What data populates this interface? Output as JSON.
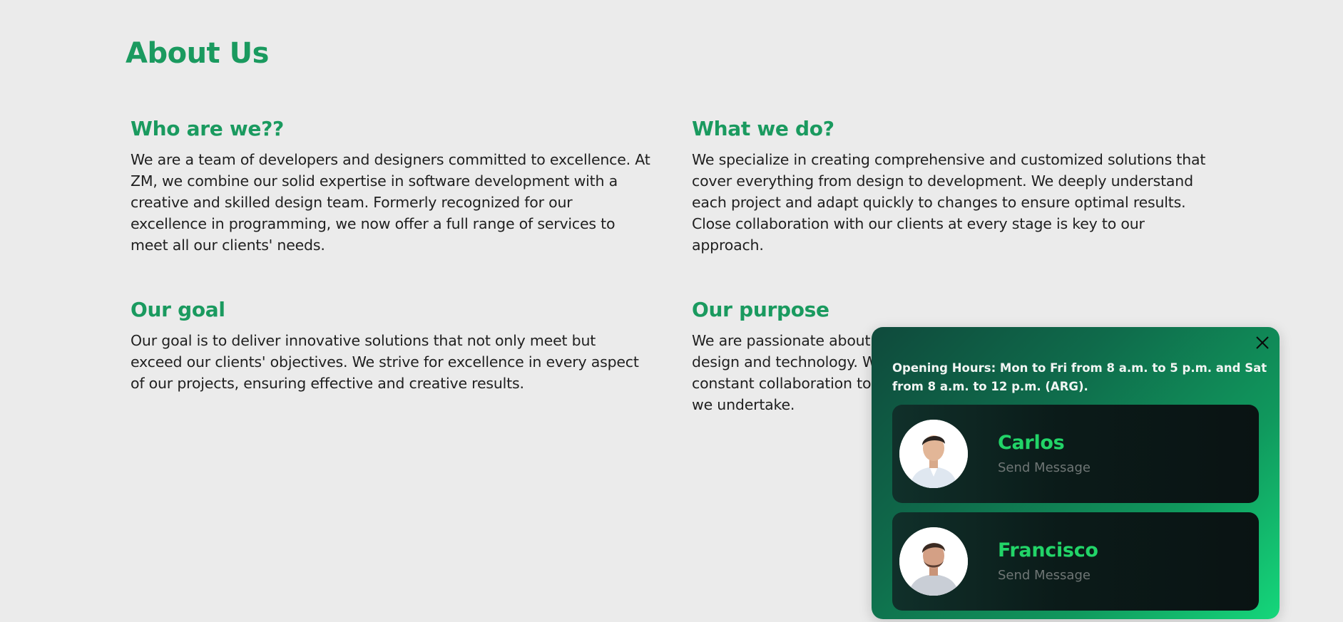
{
  "page": {
    "title": "About Us"
  },
  "sections": {
    "who": {
      "heading": "Who are we??",
      "body": "We are a team of developers and designers committed to excellence. At ZM, we combine our solid expertise in software development with a creative and skilled design team. Formerly recognized for our excellence in programming, we now offer a full range of services to meet all our clients' needs."
    },
    "what": {
      "heading": "What we do?",
      "body": "We specialize in creating comprehensive and customized solutions that cover everything from design to development. We deeply understand each project and adapt quickly to changes to ensure optimal results. Close collaboration with our clients at every stage is key to our approach."
    },
    "goal": {
      "heading": "Our goal",
      "body": "Our goal is to deliver innovative solutions that not only meet but exceed our clients' objectives. We strive for excellence in every aspect of our projects, ensuring effective and creative results."
    },
    "purpose": {
      "heading": "Our purpose",
      "body": "We are passionate about design and technology. W constant collaboration to we undertake."
    }
  },
  "chat": {
    "hours": "Opening Hours: Mon to Fri from 8 a.m. to 5 p.m. and Sat from 8 a.m. to 12 p.m. (ARG).",
    "close_icon": "close-icon",
    "contacts": [
      {
        "name": "Carlos",
        "action": "Send Message"
      },
      {
        "name": "Francisco",
        "action": "Send Message"
      }
    ]
  },
  "colors": {
    "accent": "#1a9a5f",
    "contact_name": "#22d468",
    "background": "#ebebeb"
  }
}
